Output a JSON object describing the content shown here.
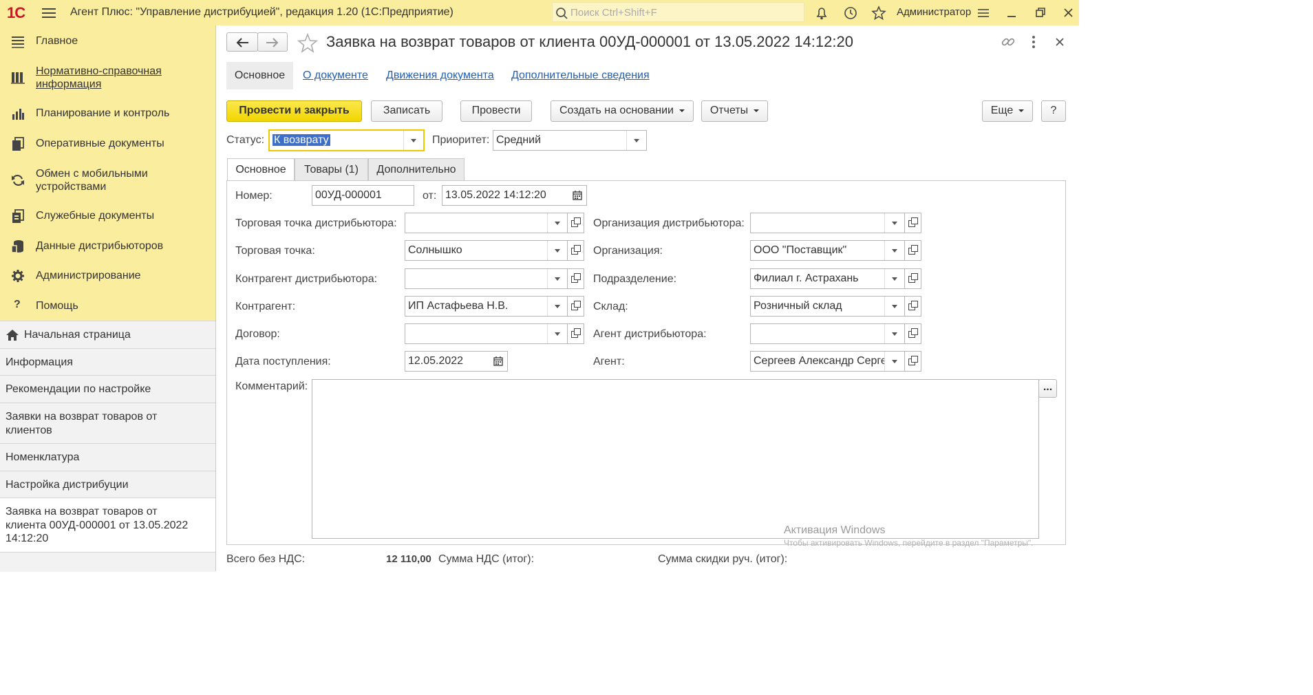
{
  "topbar": {
    "logo": "1С",
    "title": "Агент Плюс: \"Управление дистрибуцией\", редакция 1.20  (1С:Предприятие)",
    "search_placeholder": "Поиск Ctrl+Shift+F",
    "user": "Администратор"
  },
  "sidebar": {
    "items": [
      {
        "label": "Главное",
        "icon": "menu-lines-icon"
      },
      {
        "label": "Нормативно-справочная информация",
        "icon": "books-icon"
      },
      {
        "label": "Планирование и контроль",
        "icon": "bar-chart-icon"
      },
      {
        "label": "Оперативные документы",
        "icon": "documents-icon"
      },
      {
        "label": "Обмен с мобильными устройствами",
        "icon": "sync-icon"
      },
      {
        "label": "Служебные документы",
        "icon": "service-docs-icon"
      },
      {
        "label": "Данные дистрибьюторов",
        "icon": "database-icon"
      },
      {
        "label": "Администрирование",
        "icon": "gear-icon"
      },
      {
        "label": "Помощь",
        "icon": "help-icon"
      }
    ],
    "open": [
      {
        "label": "Начальная страница"
      },
      {
        "label": "Информация"
      },
      {
        "label": "Рекомендации по настройке"
      },
      {
        "label": "Заявки на возврат товаров от клиентов"
      },
      {
        "label": "Номенклатура"
      },
      {
        "label": "Настройка дистрибуции"
      },
      {
        "label": "Заявка на возврат товаров от клиента 00УД-000001 от 13.05.2022 14:12:20"
      }
    ]
  },
  "doc": {
    "title": "Заявка на возврат товаров от клиента 00УД-000001 от 13.05.2022 14:12:20",
    "nav_tabs": [
      "Основное",
      "О документе",
      "Движения документа",
      "Дополнительные сведения"
    ],
    "buttons": {
      "post_close": "Провести и закрыть",
      "save": "Записать",
      "post": "Провести",
      "create_based": "Создать на основании",
      "reports": "Отчеты",
      "more": "Еще",
      "help": "?"
    },
    "status_label": "Статус:",
    "status_value": "К возврату",
    "priority_label": "Приоритет:",
    "priority_value": "Средний",
    "tabs": [
      "Основное",
      "Товары (1)",
      "Дополнительно"
    ],
    "form": {
      "number_label": "Номер:",
      "number_value": "00УД-000001",
      "from_label": "от:",
      "date_value": "13.05.2022 14:12:20",
      "left": [
        {
          "label": "Торговая точка дистрибьютора:",
          "value": ""
        },
        {
          "label": "Торговая точка:",
          "value": "Солнышко"
        },
        {
          "label": "Контрагент дистрибьютора:",
          "value": ""
        },
        {
          "label": "Контрагент:",
          "value": "ИП Астафьева Н.В."
        },
        {
          "label": "Договор:",
          "value": ""
        }
      ],
      "right": [
        {
          "label": "Организация дистрибьютора:",
          "value": ""
        },
        {
          "label": "Организация:",
          "value": "ООО \"Поставщик\""
        },
        {
          "label": "Подразделение:",
          "value": "Филиал г. Астрахань"
        },
        {
          "label": "Склад:",
          "value": "Розничный склад"
        },
        {
          "label": "Агент дистрибьютора:",
          "value": ""
        },
        {
          "label": "Агент:",
          "value": "Сергеев Александр Сергеевич"
        }
      ],
      "receipt_label": "Дата поступления:",
      "receipt_value": "12.05.2022",
      "comment_label": "Комментарий:",
      "comment_btn": "..."
    },
    "totals": {
      "no_vat_label": "Всего без НДС:",
      "no_vat_value": "12 110,00",
      "vat_label": "Сумма НДС (итог):",
      "discount_label": "Сумма скидки руч. (итог):"
    }
  },
  "watermark": {
    "title": "Активация Windows",
    "text": "Чтобы активировать Windows, перейдите в раздел \"Параметры\"."
  }
}
